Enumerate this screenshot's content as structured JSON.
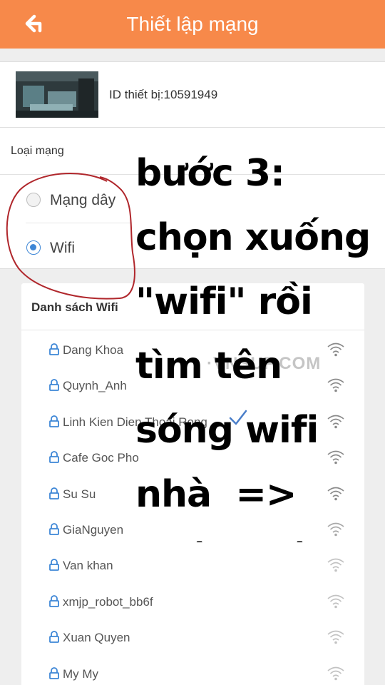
{
  "header": {
    "title": "Thiết lập mạng",
    "back_icon": "back-arrow-icon"
  },
  "device": {
    "id_text": "ID thiết bị:10591949"
  },
  "network": {
    "section_title": "Loại mạng",
    "options": [
      {
        "label": "Mạng dây",
        "selected": false
      },
      {
        "label": "Wifi",
        "selected": true
      }
    ]
  },
  "wifi_list": {
    "title": "Danh sách Wifi",
    "networks": [
      {
        "ssid": "Dang Khoa"
      },
      {
        "ssid": "Quynh_Anh"
      },
      {
        "ssid": "Linh Kien Dien Thoai Rong"
      },
      {
        "ssid": "Cafe Goc Pho"
      },
      {
        "ssid": "Su Su"
      },
      {
        "ssid": "GiaNguyen"
      },
      {
        "ssid": "Van khan"
      },
      {
        "ssid": "xmjp_robot_bb6f"
      },
      {
        "ssid": "Xuan Quyen"
      },
      {
        "ssid": "My My"
      }
    ]
  },
  "watermark": "·VNSUP.COM",
  "annotation": {
    "text": "bước 3:\nchọn xuống\n\"wifi\" rồi\ntìm tên\nsóng wifi\nnhà  =>\nnhập mật"
  },
  "colors": {
    "header": "#f7894a",
    "radio_selected": "#3d86d6",
    "annotation_circle": "#b0272c"
  }
}
